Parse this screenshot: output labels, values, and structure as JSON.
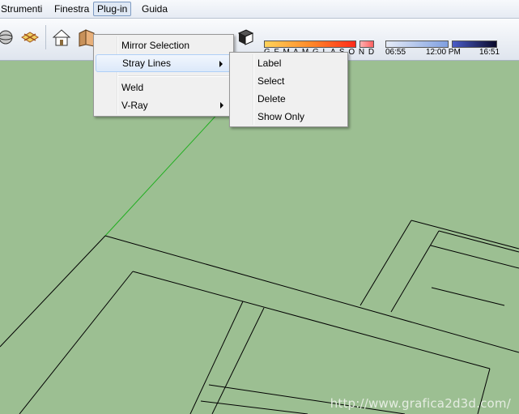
{
  "menubar": {
    "items": [
      {
        "label": "Strumenti"
      },
      {
        "label": "Finestra"
      },
      {
        "label": "Plug-in"
      },
      {
        "label": "Guida"
      }
    ]
  },
  "shadow_panel": {
    "months_letters": "G F M A M G L A S O N D",
    "time_start": "06:55",
    "time_noon": "12:00 PM",
    "time_end": "16:51"
  },
  "plugin_menu": {
    "items": [
      {
        "label": "Mirror Selection"
      },
      {
        "label": "Stray Lines"
      },
      {
        "label": "Weld"
      },
      {
        "label": "V-Ray"
      }
    ]
  },
  "stray_lines_submenu": {
    "items": [
      {
        "label": "Label"
      },
      {
        "label": "Select"
      },
      {
        "label": "Delete"
      },
      {
        "label": "Show Only"
      }
    ]
  },
  "watermark": "http://www.grafica2d3d.com/",
  "colors": {
    "viewport_bg": "#9cbf92",
    "menu_bg": "#f0f0f0",
    "green_axis": "#1fae1f"
  }
}
